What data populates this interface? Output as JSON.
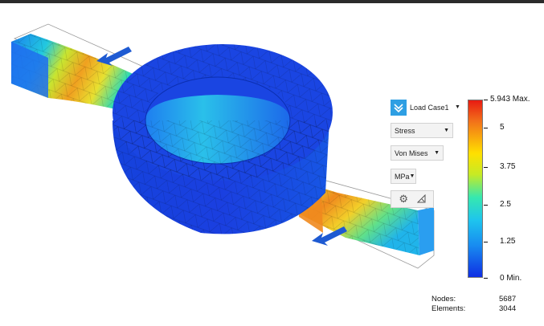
{
  "panel": {
    "load_case": "Load Case1",
    "result_type": "Stress",
    "stress_type": "Von Mises",
    "units": "MPa"
  },
  "legend": {
    "max_label": "5.943 Max.",
    "min_label": "0 Min.",
    "ticks": [
      "5",
      "3.75",
      "2.5",
      "1.25"
    ]
  },
  "mesh_stats": {
    "nodes_label": "Nodes:",
    "nodes_value": "5687",
    "elements_label": "Elements:",
    "elements_value": "3044"
  },
  "colors": {
    "accent": "#2e9fe3",
    "low_stress": "#0f2ee3",
    "high_stress": "#e81b12",
    "load_arrow": "#1e5ad2"
  }
}
